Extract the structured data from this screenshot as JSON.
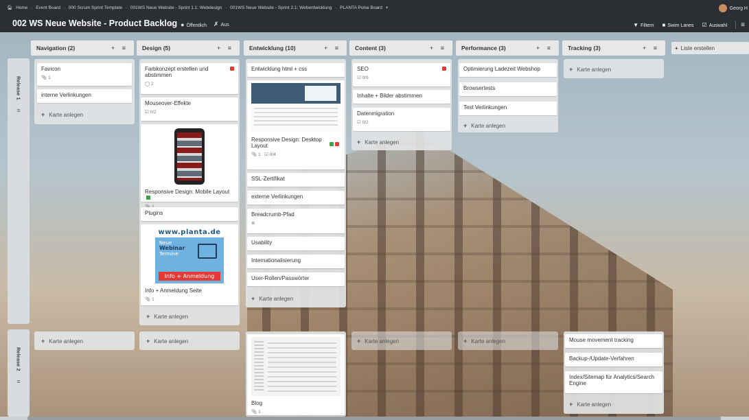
{
  "breadcrumb": [
    "Home",
    "Event Board",
    "000 Scrum Sprint Template",
    "001WS Neue Website - Sprint 1.1: Webdesign",
    "001WS Neue Website - Sprint 2.1: Webentwicklung",
    "PLANTA Pulse Board"
  ],
  "board": {
    "title": "002 WS Neue Website - Product Backlog",
    "visibility": "Öffentlich",
    "automation": "Aus"
  },
  "user": {
    "name": "Georg H"
  },
  "toolbar": {
    "filter": "Filtern",
    "swimlanes": "Swim Lanes",
    "selection": "Auswahl"
  },
  "add_list_label": "Liste erstellen",
  "add_card_label": "Karte anlegen",
  "columns": [
    {
      "title": "Navigation (2)"
    },
    {
      "title": "Design (5)"
    },
    {
      "title": "Entwicklung (10)"
    },
    {
      "title": "Content (3)"
    },
    {
      "title": "Performance (3)"
    },
    {
      "title": "Tracking (3)"
    }
  ],
  "lanes": [
    {
      "label": "Release 1"
    },
    {
      "label": "Release 2"
    }
  ],
  "cards": {
    "nav_r1": [
      {
        "title": "Favicon",
        "meta": "1"
      },
      {
        "title": "interne Verlinkungen"
      }
    ],
    "design_r1": [
      {
        "title": "Farbkonzept erstellen und abstimmen",
        "meta": "2"
      },
      {
        "title": "Mouseover-Effekte",
        "meta": "0/2"
      },
      {
        "title": "Responsive Design: Mobile Layout",
        "meta": "1"
      },
      {
        "title": "Plugins"
      },
      {
        "title": "Info + Anmeldung Seite",
        "meta": "1"
      }
    ],
    "dev_r1": [
      {
        "title": "Entwicklung html + css"
      },
      {
        "title": "Responsive Design: Desktop Layout",
        "meta": "1",
        "meta2": "0/4"
      },
      {
        "title": "SSL-Zertifikat"
      },
      {
        "title": "externe Verlinkungen"
      },
      {
        "title": "Breadcrumb-Pfad"
      },
      {
        "title": "Usability"
      },
      {
        "title": "Internationalisierung"
      },
      {
        "title": "User-Rollen/Passwörter"
      }
    ],
    "content_r1": [
      {
        "title": "SEO",
        "meta": "0/9"
      },
      {
        "title": "Inhalte + Bilder abstimmen"
      },
      {
        "title": "Datenmigration",
        "meta": "0/2"
      }
    ],
    "perf_r1": [
      {
        "title": "Optimierung Ladezeit Webshop"
      },
      {
        "title": "Browsertests"
      },
      {
        "title": "Test Verlinkungen"
      }
    ],
    "dev_r2": [
      {
        "title": "Blog",
        "meta": "1"
      }
    ],
    "tracking_r2": [
      {
        "title": "Mouse movement tracking"
      },
      {
        "title": "Backup-/Update-Verfahren"
      },
      {
        "title": "Index/Sitemap für Analytics/Search Engine"
      }
    ]
  },
  "ad": {
    "url": "www.planta.de",
    "line1": "Neue",
    "line2": "Webinar",
    "line3": "Termine",
    "cta": "Info + Anmeldung"
  },
  "colors": {
    "tag_red": "#e53935",
    "tag_green": "#43a047",
    "topbar": "#2b2f33"
  }
}
